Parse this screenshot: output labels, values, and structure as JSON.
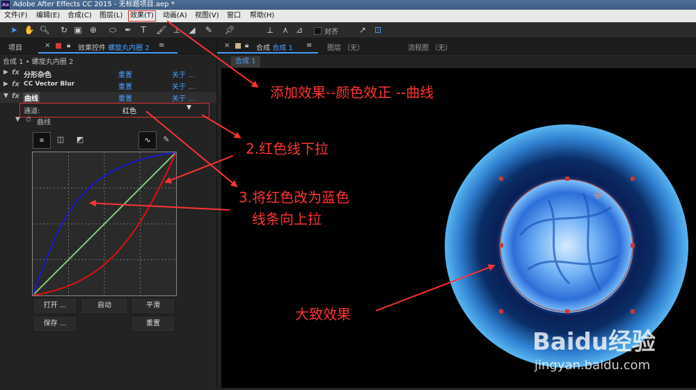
{
  "window": {
    "title": "Adobe After Effects CC 2015 - 无标题项目.aep *",
    "app_badge": "Ae"
  },
  "menu": [
    "文件(F)",
    "编辑(E)",
    "合成(C)",
    "图层(L)",
    "效果(T)",
    "动画(A)",
    "视图(V)",
    "窗口",
    "帮助(H)"
  ],
  "toolbar": {
    "align_label": "对齐"
  },
  "left_panel": {
    "tab_project": "项目",
    "tab_effects_prefix": "效果控件",
    "tab_effects_layer": "螺旋丸内圈 2",
    "breadcrumb": "合成 1 • 螺旋丸内圈 2",
    "effects": [
      {
        "name": "分形杂色",
        "reset": "重置",
        "about": "关于 ..."
      },
      {
        "name": "CC Vector Blur",
        "reset": "重置",
        "about": "关于 ..."
      },
      {
        "name": "曲线",
        "reset": "重置",
        "about": "关于 ..."
      }
    ],
    "channel_label": "通道:",
    "channel_value": "红色",
    "curves_label": "曲线",
    "buttons": {
      "open": "打开 ...",
      "auto": "自动",
      "smooth": "平滑",
      "save": "保存 ...",
      "reset": "重置"
    }
  },
  "viewer": {
    "tab_comp_prefix": "合成",
    "tab_comp_name": "合成 1",
    "tab_layer": "图层 （无）",
    "tab_flow": "流程图 （无）",
    "sub_tab": "合成 1"
  },
  "annotations": {
    "a1": "添加效果--颜色效正 --曲线",
    "a2": "2.红色线下拉",
    "a3_line1": "3.将红色改为蓝色",
    "a3_line2": "线条向上拉",
    "a4": "大致效果"
  },
  "watermark": {
    "brand": "Baidu经验",
    "url": "jingyan.baidu.com"
  },
  "colors": {
    "accent": "#4aa0ff",
    "annotation": "#ff3333",
    "red_curve": "#e01010",
    "blue_curve": "#1a1ad0",
    "green_curve": "#7fcf7f"
  }
}
